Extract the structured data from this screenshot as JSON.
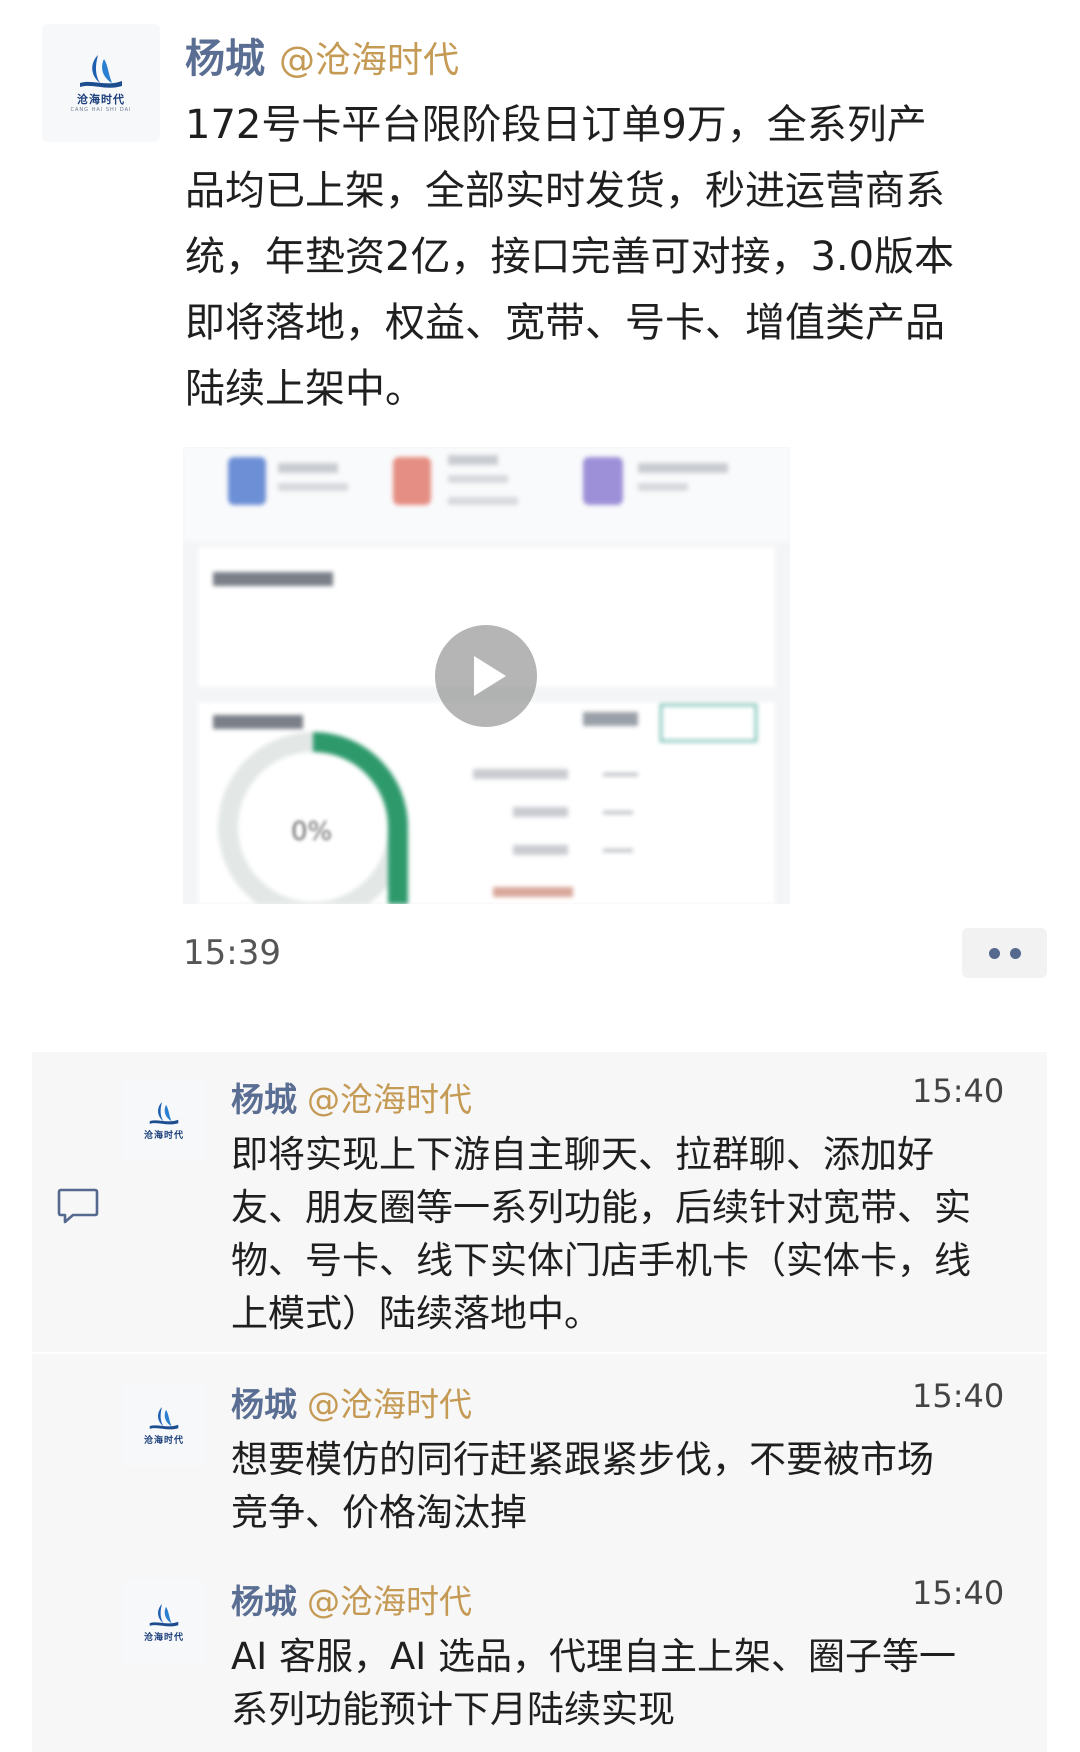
{
  "post": {
    "author": "杨城",
    "handle": "@沧海时代",
    "text_lines": [
      "172号卡平台限阶段日订单9万，全系列产",
      "品均已上架，全部实时发货，秒进运营商系",
      "统，年垫资2亿，接口完善可对接，3.0版本",
      "即将落地，权益、宽带、号卡、增值类产品",
      "陆续上架中。"
    ],
    "time": "15:39",
    "video": {
      "donut_percent": "0%"
    }
  },
  "logo": {
    "text": "沧海时代",
    "sub": "CANG HAI SHI DAI"
  },
  "comments": [
    {
      "author": "杨城",
      "handle": "@沧海时代",
      "time": "15:40",
      "lines": [
        "即将实现上下游自主聊天、拉群聊、添加好",
        "友、朋友圈等一系列功能，后续针对宽带、实",
        "物、号卡、线下实体门店手机卡（实体卡，线",
        "上模式）陆续落地中。"
      ]
    },
    {
      "author": "杨城",
      "handle": "@沧海时代",
      "time": "15:40",
      "lines": [
        "想要模仿的同行赶紧跟紧步伐，不要被市场",
        "竞争、价格淘汰掉"
      ]
    },
    {
      "author": "杨城",
      "handle": "@沧海时代",
      "time": "15:40",
      "lines": [
        "AI 客服，AI 选品，代理自主上架、圈子等一",
        "系列功能预计下月陆续实现"
      ]
    }
  ],
  "icons": {
    "comment": "comment-bubble-icon",
    "play": "play-icon",
    "more": "more-dots-icon"
  },
  "colors": {
    "name": "#5a6e93",
    "handle": "#c49a55",
    "donut": "#2e9a6c"
  }
}
